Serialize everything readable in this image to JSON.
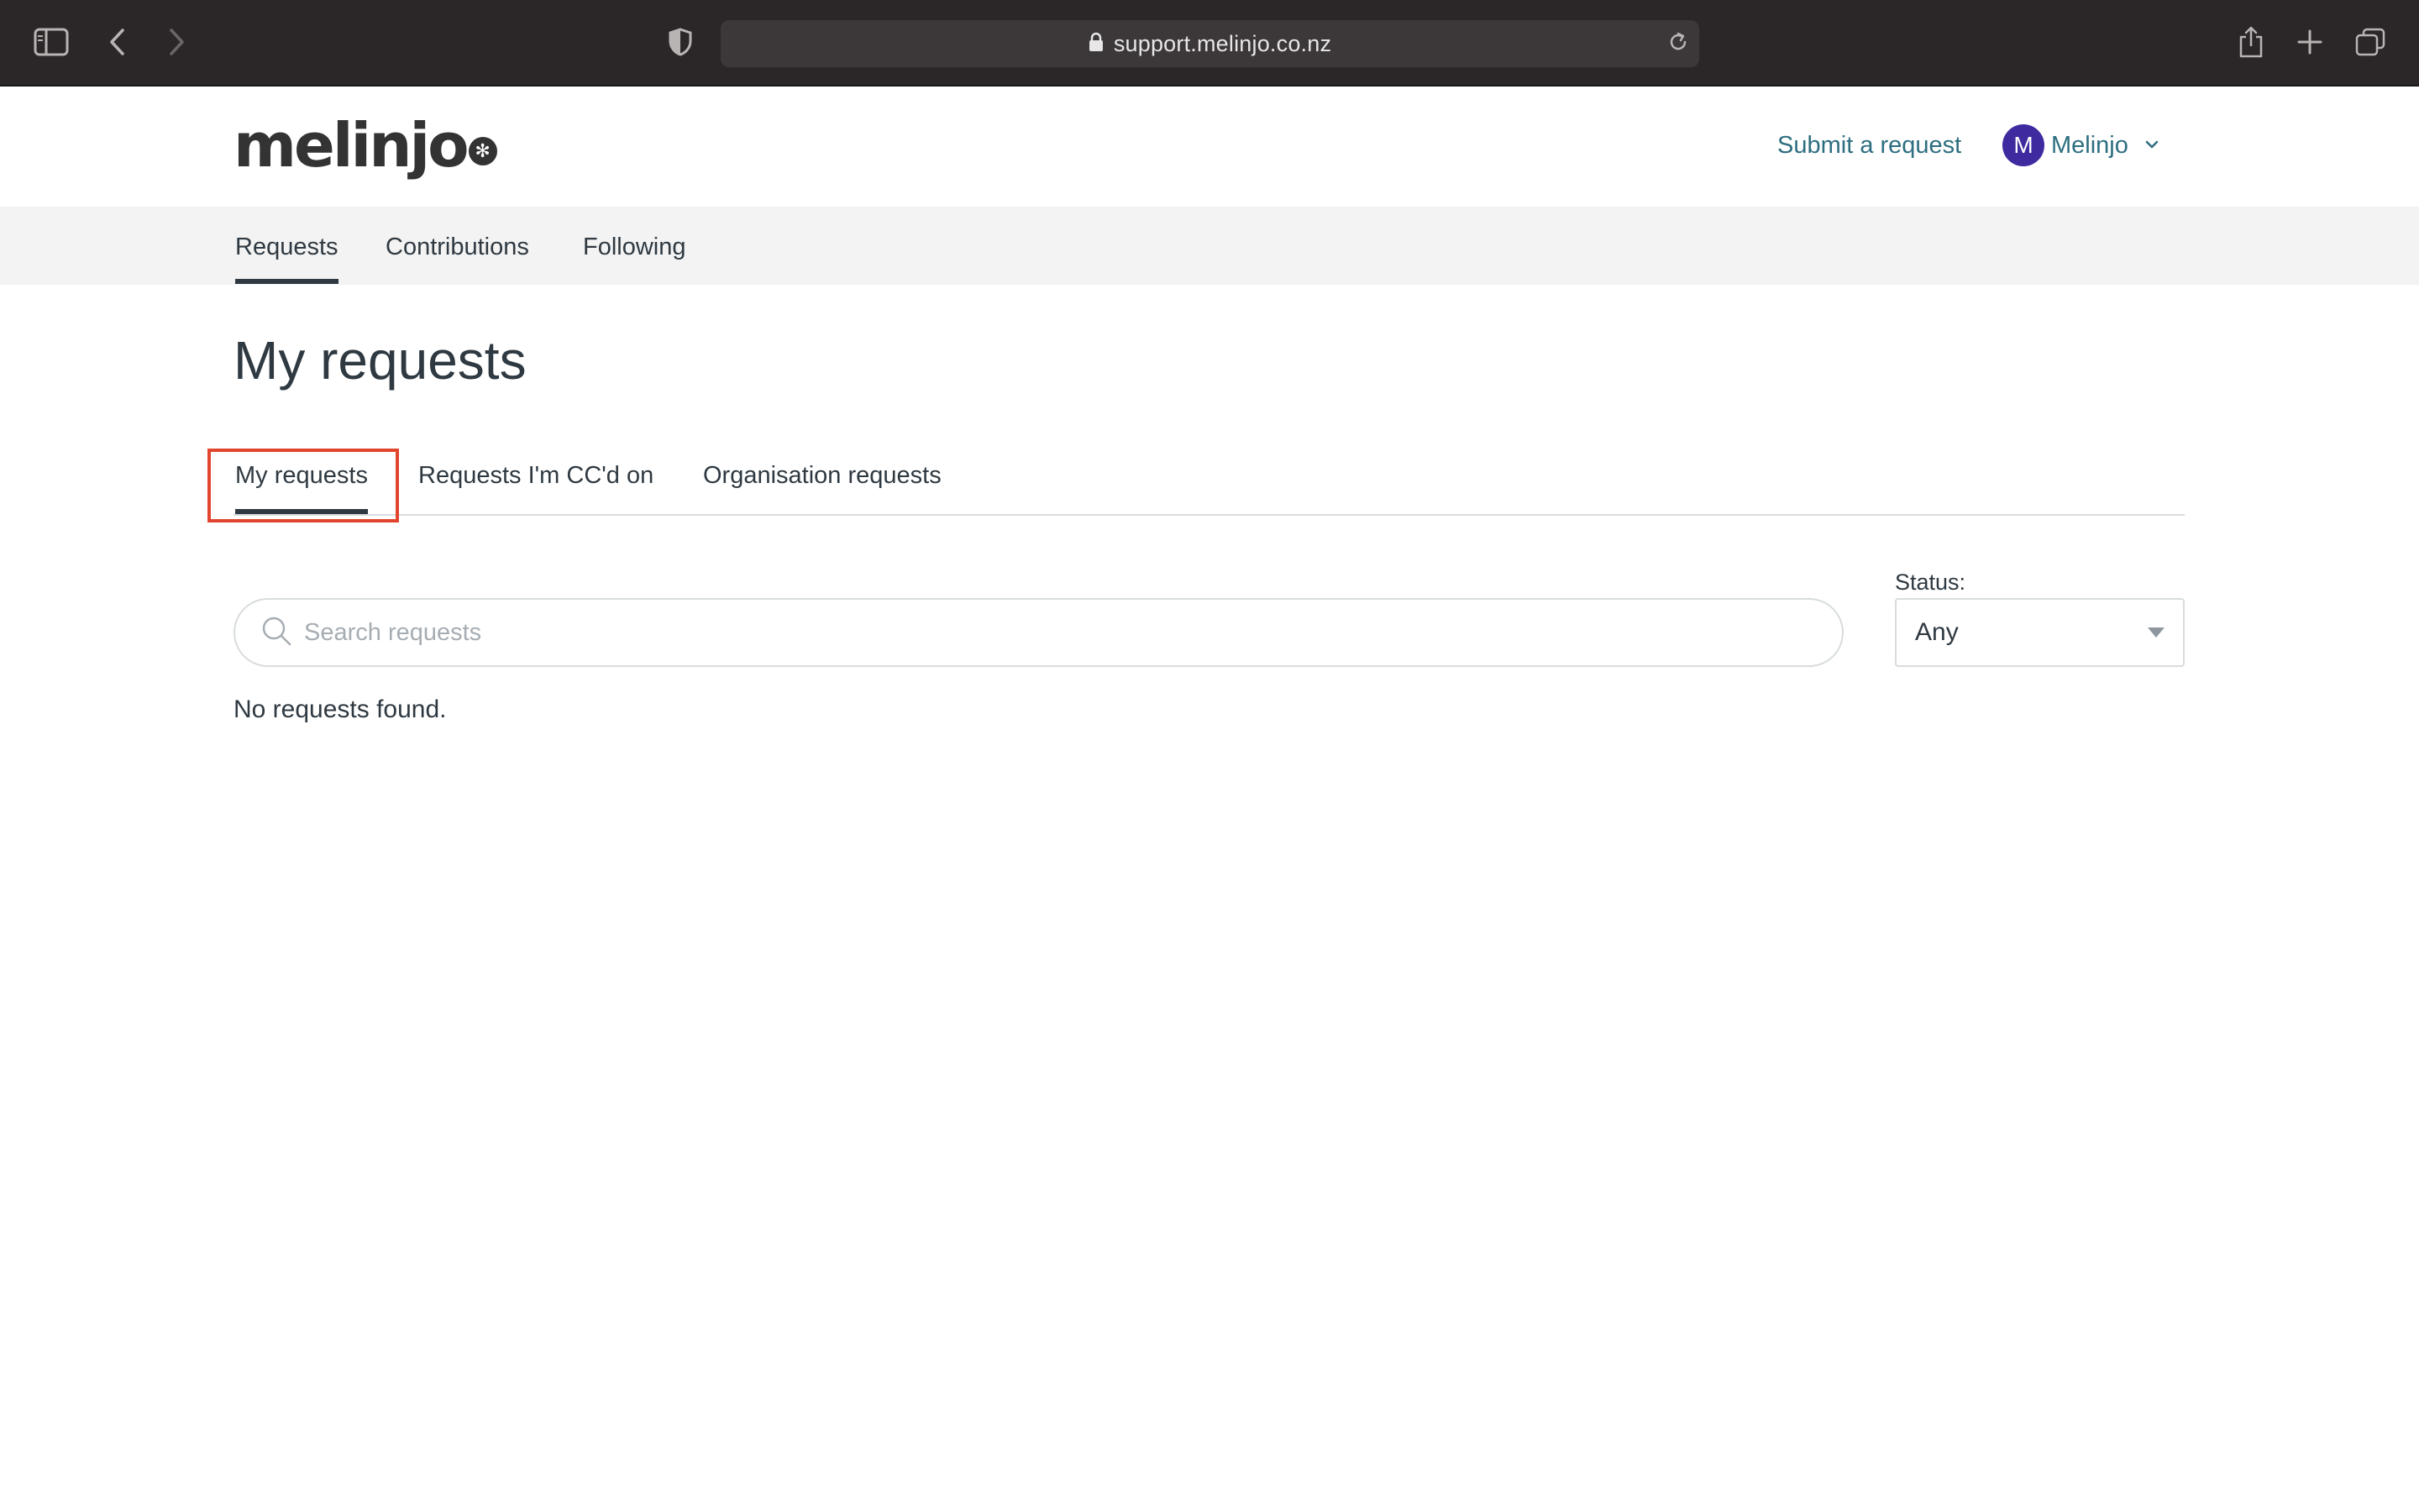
{
  "browser": {
    "url": "support.melinjo.co.nz"
  },
  "header": {
    "logo_text": "melinjo",
    "submit_request": "Submit a request",
    "user_initial": "M",
    "user_name": "Melinjo"
  },
  "sub_nav": {
    "items": [
      {
        "label": "Requests",
        "active": true
      },
      {
        "label": "Contributions",
        "active": false
      },
      {
        "label": "Following",
        "active": false
      }
    ]
  },
  "main": {
    "title": "My requests",
    "tabs": [
      {
        "label": "My requests",
        "active": true
      },
      {
        "label": "Requests I'm CC'd on",
        "active": false
      },
      {
        "label": "Organisation requests",
        "active": false
      }
    ],
    "search": {
      "placeholder": "Search requests",
      "value": ""
    },
    "status": {
      "label": "Status:",
      "selected": "Any"
    },
    "empty_message": "No requests found."
  },
  "colors": {
    "chrome_bg": "#2b2728",
    "accent_link": "#2d6e80",
    "avatar_bg": "#3f2aa0",
    "highlight": "#e2452d",
    "subnav_bg": "#f3f3f3"
  },
  "icons": [
    "sidebar-icon",
    "back-icon",
    "forward-icon",
    "shield-icon",
    "lock-icon",
    "reload-icon",
    "share-icon",
    "new-tab-icon",
    "tabs-overview-icon",
    "chevron-down-icon",
    "search-icon",
    "caret-down-icon"
  ]
}
